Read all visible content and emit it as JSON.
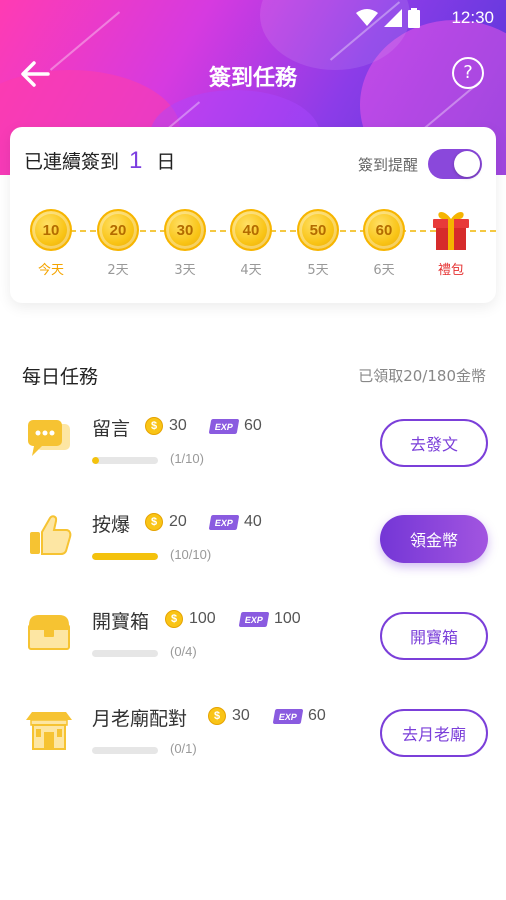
{
  "status": {
    "time": "12:30"
  },
  "nav": {
    "title": "簽到任務",
    "help": "?"
  },
  "checkin": {
    "streak_prefix": "已連續簽到",
    "streak_days": "1",
    "streak_suffix": "日",
    "reminder_label": "簽到提醒",
    "reminder_on": true,
    "days": [
      {
        "value": "10",
        "label": "今天"
      },
      {
        "value": "20",
        "label": "2天"
      },
      {
        "value": "30",
        "label": "3天"
      },
      {
        "value": "40",
        "label": "4天"
      },
      {
        "value": "50",
        "label": "5天"
      },
      {
        "value": "60",
        "label": "6天"
      },
      {
        "value": "",
        "label": "禮包"
      }
    ]
  },
  "tasks": {
    "title": "每日任務",
    "progress": "已領取20/180金幣",
    "coin_symbol": "$",
    "exp_symbol": "EXP",
    "items": [
      {
        "name": "留言",
        "coins": "30",
        "exp": "60",
        "count": "(1/10)",
        "progress": 0.1,
        "button": "去發文",
        "icon": "chat-bubble-icon"
      },
      {
        "name": "按爆",
        "coins": "20",
        "exp": "40",
        "count": "(10/10)",
        "progress": 1.0,
        "button": "領金幣",
        "icon": "thumbs-up-icon"
      },
      {
        "name": "開寶箱",
        "coins": "100",
        "exp": "100",
        "count": "(0/4)",
        "progress": 0,
        "button": "開寶箱",
        "icon": "treasure-chest-icon"
      },
      {
        "name": "月老廟配對",
        "coins": "30",
        "exp": "60",
        "count": "(0/1)",
        "progress": 0,
        "button": "去月老廟",
        "icon": "temple-icon"
      }
    ]
  },
  "colors": {
    "accent": "#7b3fd9",
    "coin": "#f9c416",
    "today": "#f4a400",
    "gift": "#e53030"
  }
}
